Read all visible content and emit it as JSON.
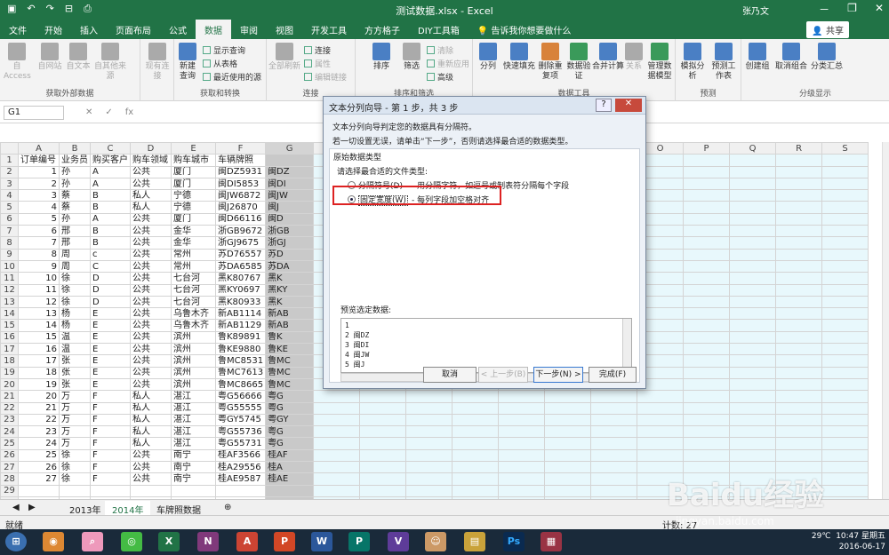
{
  "window": {
    "doc_title": "测试数据.xlsx - Excel",
    "user": "张乃文",
    "controls": [
      "－",
      "❐",
      "✕"
    ]
  },
  "tabs": [
    "文件",
    "开始",
    "插入",
    "页面布局",
    "公式",
    "数据",
    "审阅",
    "视图",
    "开发工具",
    "方方格子",
    "DIY工具箱",
    "告诉我你想要做什么"
  ],
  "active_tab": "数据",
  "share": "共享",
  "ribbon": {
    "groups": [
      {
        "label": "获取外部数据",
        "buttons": [
          "自 Access",
          "自网站",
          "自文本",
          "自其他来源",
          "现有连接"
        ]
      },
      {
        "label": "获取和转换",
        "buttons": [
          "新建查询",
          "显示查询",
          "从表格",
          "最近使用的源"
        ]
      },
      {
        "label": "连接",
        "buttons": [
          "全部刷新",
          "连接",
          "属性",
          "编辑链接"
        ]
      },
      {
        "label": "排序和筛选",
        "buttons": [
          "排序",
          "筛选",
          "清除",
          "重新应用",
          "高级"
        ]
      },
      {
        "label": "数据工具",
        "buttons": [
          "分列",
          "快速填充",
          "删除重复项",
          "数据验证",
          "合并计算",
          "关系",
          "管理数据模型"
        ]
      },
      {
        "label": "预测",
        "buttons": [
          "模拟分析",
          "预测工作表"
        ]
      },
      {
        "label": "分级显示",
        "buttons": [
          "创建组",
          "取消组合",
          "分类汇总"
        ]
      }
    ]
  },
  "formula_bar": {
    "name_box": "G1",
    "fx": "fx",
    "cancel": "✕",
    "enter": "✓"
  },
  "sheet": {
    "col_headers": [
      "A",
      "B",
      "C",
      "D",
      "E",
      "F",
      "G",
      "H",
      "I",
      "J",
      "K",
      "L",
      "M",
      "N",
      "O",
      "P",
      "Q",
      "R",
      "S"
    ],
    "rows": [
      [
        "订单编号",
        "业务员",
        "购买客户",
        "购车领域",
        "购车城市",
        "车辆牌照",
        ""
      ],
      [
        "1",
        "孙",
        "A",
        "公共",
        "厦门",
        "闽DZ5931",
        "闽DZ"
      ],
      [
        "2",
        "孙",
        "A",
        "公共",
        "厦门",
        "闽DI5853",
        "闽DI"
      ],
      [
        "3",
        "蔡",
        "B",
        "私人",
        "宁德",
        "闽JW6872",
        "闽JW"
      ],
      [
        "4",
        "蔡",
        "B",
        "私人",
        "宁德",
        "闽J26870",
        "闽J"
      ],
      [
        "5",
        "孙",
        "A",
        "公共",
        "厦门",
        "闽D66116",
        "闽D"
      ],
      [
        "6",
        "邢",
        "B",
        "公共",
        "金华",
        "浙GB9672",
        "浙GB"
      ],
      [
        "7",
        "邢",
        "B",
        "公共",
        "金华",
        "浙GJ9675",
        "浙GJ"
      ],
      [
        "8",
        "周",
        "c",
        "公共",
        "常州",
        "苏D76557",
        "苏D"
      ],
      [
        "9",
        "周",
        "C",
        "公共",
        "常州",
        "苏DA6585",
        "苏DA"
      ],
      [
        "10",
        "徐",
        "D",
        "公共",
        "七台河",
        "黑K80767",
        "黑K"
      ],
      [
        "11",
        "徐",
        "D",
        "公共",
        "七台河",
        "黑KY0697",
        "黑KY"
      ],
      [
        "12",
        "徐",
        "D",
        "公共",
        "七台河",
        "黑K80933",
        "黑K"
      ],
      [
        "13",
        "杨",
        "E",
        "公共",
        "乌鲁木齐",
        "新AB1114",
        "新AB"
      ],
      [
        "14",
        "杨",
        "E",
        "公共",
        "乌鲁木齐",
        "新AB1129",
        "新AB"
      ],
      [
        "15",
        "温",
        "E",
        "公共",
        "滨州",
        "鲁K89891",
        "鲁K"
      ],
      [
        "16",
        "温",
        "E",
        "公共",
        "滨州",
        "鲁KE9880",
        "鲁KE"
      ],
      [
        "17",
        "张",
        "E",
        "公共",
        "滨州",
        "鲁MC8531",
        "鲁MC"
      ],
      [
        "18",
        "张",
        "E",
        "公共",
        "滨州",
        "鲁MC7613",
        "鲁MC"
      ],
      [
        "19",
        "张",
        "E",
        "公共",
        "滨州",
        "鲁MC8665",
        "鲁MC"
      ],
      [
        "20",
        "万",
        "F",
        "私人",
        "湛江",
        "粤G56666",
        "粤G"
      ],
      [
        "21",
        "万",
        "F",
        "私人",
        "湛江",
        "粤G55555",
        "粤G"
      ],
      [
        "22",
        "万",
        "F",
        "私人",
        "湛江",
        "粤GY5745",
        "粤GY"
      ],
      [
        "23",
        "万",
        "F",
        "私人",
        "湛江",
        "粤G55736",
        "粤G"
      ],
      [
        "24",
        "万",
        "F",
        "私人",
        "湛江",
        "粤G55731",
        "粤G"
      ],
      [
        "25",
        "徐",
        "F",
        "公共",
        "南宁",
        "桂AF3566",
        "桂AF"
      ],
      [
        "26",
        "徐",
        "F",
        "公共",
        "南宁",
        "桂A29556",
        "桂A"
      ],
      [
        "27",
        "徐",
        "F",
        "公共",
        "南宁",
        "桂AE9587",
        "桂AE"
      ],
      [
        "",
        "",
        "",
        "",
        "",
        "",
        ""
      ],
      [
        "",
        "",
        "",
        "",
        "",
        "",
        ""
      ],
      [
        "",
        "",
        "",
        "",
        "",
        "",
        ""
      ]
    ]
  },
  "sheet_tabs": [
    "2013年",
    "2014年",
    "车牌照数据"
  ],
  "active_sheet": "2014年",
  "status": {
    "ready": "就绪",
    "count": "计数: 27"
  },
  "dialog": {
    "title": "文本分列向导 - 第 1 步，共 3 步",
    "help": "?",
    "close": "✕",
    "line1": "文本分列向导判定您的数据具有分隔符。",
    "line2": "若一切设置无误，请单击“下一步”，否则请选择最合适的数据类型。",
    "section": "原始数据类型",
    "prompt": "请选择最合适的文件类型:",
    "opt1_label": "分隔符号(D)",
    "opt1_desc": "- 用分隔字符，如逗号或制表符分隔每个字段",
    "opt2_label": "固定宽度(W)",
    "opt2_desc": "- 每列字段加空格对齐",
    "preview_label": "预览选定数据:",
    "preview_lines": [
      "1",
      "2 闽DZ",
      "3 闽DI",
      "4 闽JW",
      "5 闽J"
    ],
    "buttons": {
      "cancel": "取消",
      "back": "< 上一步(B)",
      "next": "下一步(N) >",
      "finish": "完成(F)"
    }
  },
  "taskbar": {
    "time": "10:47 星期五",
    "date": "2016-06-17",
    "temp": "29℃"
  },
  "watermark": {
    "brand": "Baidu经验",
    "url": "jingyan.baidu.com"
  }
}
